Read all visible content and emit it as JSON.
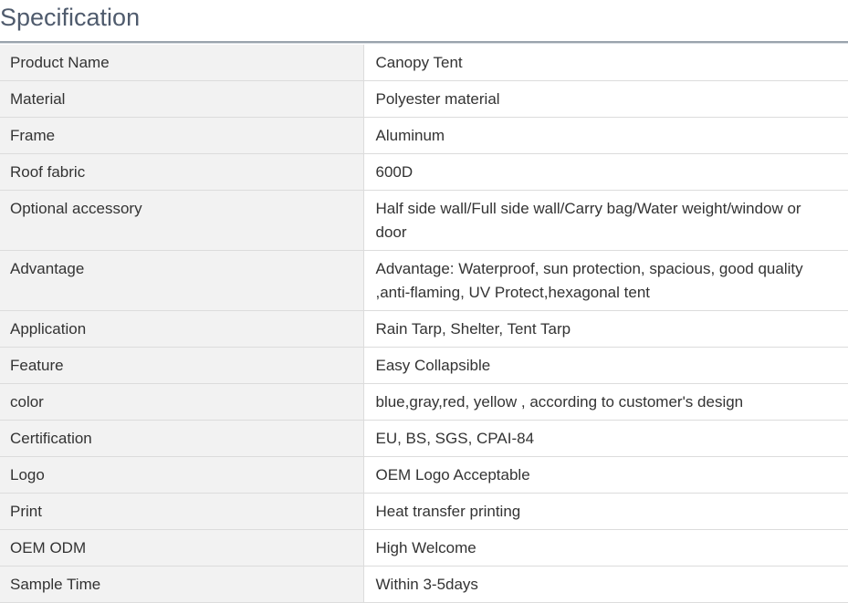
{
  "section": {
    "title": "Specification"
  },
  "spec_table": {
    "rows": [
      {
        "key": "Product Name",
        "value": "Canopy Tent"
      },
      {
        "key": "Material",
        "value": "Polyester material"
      },
      {
        "key": "Frame",
        "value": "Aluminum"
      },
      {
        "key": "Roof fabric",
        "value": "600D"
      },
      {
        "key": "Optional accessory",
        "value": "Half side wall/Full side wall/Carry bag/Water weight/window or door"
      },
      {
        "key": "Advantage",
        "value": "Advantage: Waterproof, sun protection, spacious, good quality ,anti-flaming, UV Protect,hexagonal tent"
      },
      {
        "key": "Application",
        "value": "Rain Tarp, Shelter, Tent Tarp"
      },
      {
        "key": "Feature",
        "value": "Easy Collapsible"
      },
      {
        "key": "color",
        "value": "blue,gray,red, yellow , according to customer's design"
      },
      {
        "key": "Certification",
        "value": "EU, BS, SGS, CPAI-84"
      },
      {
        "key": "Logo",
        "value": "OEM Logo Acceptable"
      },
      {
        "key": "Print",
        "value": "Heat transfer printing"
      },
      {
        "key": "OEM ODM",
        "value": "High Welcome"
      },
      {
        "key": "Sample Time",
        "value": "Within 3-5days"
      }
    ]
  }
}
